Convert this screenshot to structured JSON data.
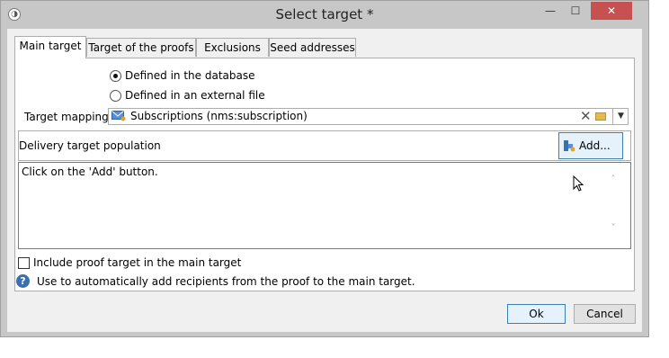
{
  "window": {
    "title": "Select target *",
    "minimize_glyph": "—",
    "maximize_glyph": "☐",
    "close_glyph": "✕",
    "icons": [
      "app-icon"
    ]
  },
  "tabs": [
    {
      "label": "Main target",
      "active": true
    },
    {
      "label": "Target of the proofs",
      "active": false
    },
    {
      "label": "Exclusions",
      "active": false
    },
    {
      "label": "Seed addresses",
      "active": false
    }
  ],
  "source": {
    "options": [
      {
        "label": "Defined in the database",
        "selected": true
      },
      {
        "label": "Defined in an external file",
        "selected": false
      }
    ]
  },
  "mapping": {
    "label": "Target mapping:",
    "value": "Subscriptions (nms:subscription)",
    "icons": [
      "envelope-icon",
      "clear-icon",
      "folder-icon",
      "dropdown-arrow-icon"
    ],
    "clear_glyph": "✕",
    "dropdown_glyph": "▼"
  },
  "population": {
    "label": "Delivery target population",
    "add_label": "Add...",
    "placeholder_text": "Click on the 'Add' button.",
    "scroll_up_glyph": "˄",
    "scroll_down_glyph": "˅"
  },
  "proof": {
    "checkbox_label": "Include proof target in the main target",
    "checked": false,
    "help_glyph": "?",
    "help_text": "Use to automatically add recipients from the proof to the main target."
  },
  "buttons": {
    "ok": "Ok",
    "cancel": "Cancel"
  },
  "colors": {
    "title_bar": "#c7c7c7",
    "close_button": "#c75050",
    "dialog_background": "#f0f0f0",
    "focus_border": "#3c7fb1",
    "help_icon": "#3a6fb0"
  }
}
